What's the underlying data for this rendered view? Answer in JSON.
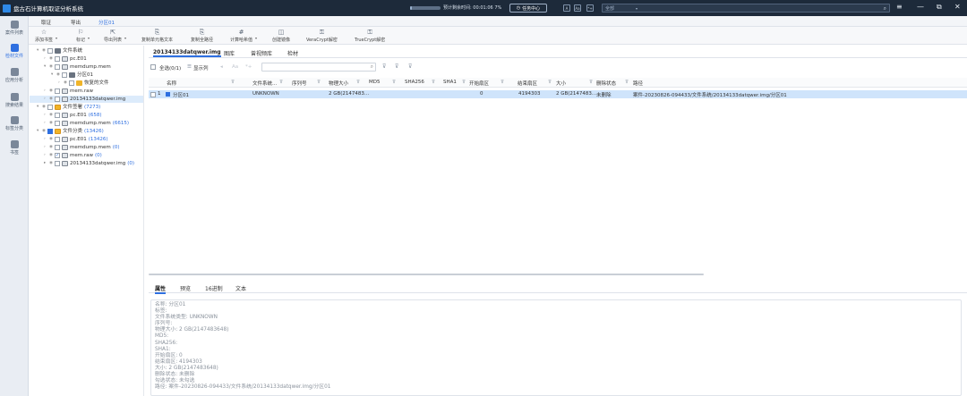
{
  "titlebar": {
    "title": "盘古石计算机取证分析系统",
    "progress_percent": 7,
    "eta": "预计剩余时间: 00:01:06 7%",
    "task_center": "任务中心",
    "btn_a": "A",
    "btn_aa": "Aa",
    "btn_star": "*+",
    "scope": "全部",
    "win_menu": "≡",
    "win_min": "—",
    "win_max": "⧉",
    "win_close": "✕"
  },
  "leftnav": [
    {
      "label": "案件列表",
      "active": false
    },
    {
      "label": "检材文件",
      "active": true
    },
    {
      "label": "应用分析",
      "active": false
    },
    {
      "label": "搜索结果",
      "active": false
    },
    {
      "label": "标签分类",
      "active": false
    },
    {
      "label": "书签",
      "active": false
    }
  ],
  "menubar": [
    "取证",
    "导出",
    "分区01"
  ],
  "toolbar": [
    {
      "label": "添加书签",
      "icon": "☆",
      "dropdown": true
    },
    {
      "label": "标记",
      "icon": "⚐",
      "dropdown": true
    },
    {
      "label": "导出列表",
      "icon": "⇱",
      "dropdown": true
    },
    {
      "label": "复制单元格文本",
      "icon": "⎘",
      "dropdown": false
    },
    {
      "label": "复制全路径",
      "icon": "⎘",
      "dropdown": false
    },
    {
      "label": "计算哈希值",
      "icon": "#",
      "dropdown": true
    },
    {
      "label": "创建镜像",
      "icon": "◫",
      "dropdown": false
    },
    {
      "label": "VeraCrypt解密",
      "icon": "⚿",
      "dropdown": false
    },
    {
      "label": "TrueCrypt解密",
      "icon": "⚿",
      "dropdown": false
    }
  ],
  "tree": [
    {
      "label": "文件系统",
      "count": "",
      "level": 0,
      "icon": "drive",
      "exp": "▾",
      "cb": "",
      "sel": false
    },
    {
      "label": "pc.E01",
      "count": "",
      "level": 1,
      "icon": "disk",
      "exp": "›",
      "cb": "",
      "sel": false
    },
    {
      "label": "memdump.mem",
      "count": "",
      "level": 1,
      "icon": "disk",
      "exp": "▾",
      "cb": "",
      "sel": false
    },
    {
      "label": "分区01",
      "count": "",
      "level": 2,
      "icon": "drive",
      "exp": "▾",
      "cb": "",
      "sel": false
    },
    {
      "label": "恢复的文件",
      "count": "",
      "level": 3,
      "icon": "folder",
      "exp": "›",
      "cb": "",
      "sel": false
    },
    {
      "label": "mem.raw",
      "count": "",
      "level": 1,
      "icon": "disk",
      "exp": "›",
      "cb": "",
      "sel": false
    },
    {
      "label": "20134133datqwer.img",
      "count": "",
      "level": 1,
      "icon": "disk",
      "exp": "›",
      "cb": "",
      "sel": true
    },
    {
      "label": "文件签署",
      "count": "(7273)",
      "level": 0,
      "icon": "folderb",
      "exp": "▾",
      "cb": "",
      "sel": false
    },
    {
      "label": "pc.E01",
      "count": "(658)",
      "level": 1,
      "icon": "disk",
      "exp": "›",
      "cb": "",
      "sel": false
    },
    {
      "label": "memdump.mem",
      "count": "(6615)",
      "level": 1,
      "icon": "disk",
      "exp": "›",
      "cb": "",
      "sel": false
    },
    {
      "label": "文件分类",
      "count": "(13426)",
      "level": 0,
      "icon": "folderb",
      "exp": "▾",
      "cb": "part",
      "sel": false
    },
    {
      "label": "pc.E01",
      "count": "(13426)",
      "level": 1,
      "icon": "disk",
      "exp": "›",
      "cb": "",
      "sel": false
    },
    {
      "label": "memdump.mem",
      "count": "(0)",
      "level": 1,
      "icon": "disk",
      "exp": "›",
      "cb": "",
      "sel": false
    },
    {
      "label": "mem.raw",
      "count": "(0)",
      "level": 1,
      "icon": "disk",
      "exp": "›",
      "cb": "check",
      "sel": false
    },
    {
      "label": "20134133datqwer.img",
      "count": "(0)",
      "level": 1,
      "icon": "disk",
      "exp": "▸",
      "cb": "",
      "sel": false
    }
  ],
  "tabs": [
    "20134133datqwer.img",
    "图库",
    "曾视频库",
    "检材"
  ],
  "filterbar": {
    "select_all": "全选(0/1)",
    "display_cols": "显示列",
    "search_placeholder": ""
  },
  "columns": [
    "名称",
    "文件系统...",
    "序列号",
    "物理大小",
    "MD5",
    "SHA256",
    "SHA1",
    "开始扇区",
    "结束扇区",
    "大小",
    "删除状态",
    "路径"
  ],
  "rows": [
    {
      "idx": "1",
      "name": "分区01",
      "fs": "UNKNOWN",
      "serial": "",
      "physical": "2 GB(2147483...",
      "md5": "",
      "sha256": "",
      "sha1": "",
      "start": "0",
      "end": "4194303",
      "size": "2 GB(2147483...",
      "deleted": "未删除",
      "path": "案件-20230826-094433/文件系统/20134133datqwer.img/分区01"
    }
  ],
  "bottomtabs": [
    "属性",
    "预览",
    "16进制",
    "文本"
  ],
  "props": [
    "名称: 分区01",
    "标签:",
    "文件系统类型: UNKNOWN",
    "序列号:",
    "物理大小: 2 GB(2147483648)",
    "MD5:",
    "SHA256:",
    "SHA1:",
    "开始扇区: 0",
    "结束扇区: 4194303",
    "大小: 2 GB(2147483648)",
    "删除状态: 未删除",
    "勾选状态: 未勾选",
    "路径: 案件-20230826-094433/文件系统/20134133datqwer.img/分区01"
  ]
}
